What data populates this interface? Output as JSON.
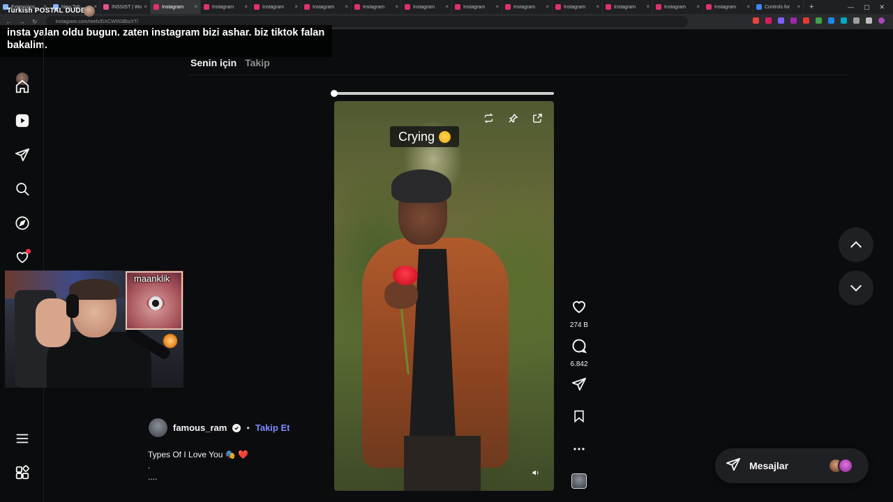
{
  "browser": {
    "tabs": [
      {
        "label": "Extensions",
        "color": "#8ab4f8"
      },
      {
        "label": "New Tab",
        "color": "#8ab4f8"
      },
      {
        "label": "INSSIST | Wo",
        "color": "#e8508a"
      },
      {
        "label": "Instagram",
        "color": "#e1306c",
        "active": true
      },
      {
        "label": "Instagram",
        "color": "#e1306c"
      },
      {
        "label": "Instagram",
        "color": "#e1306c"
      },
      {
        "label": "Instagram",
        "color": "#e1306c"
      },
      {
        "label": "Instagram",
        "color": "#e1306c"
      },
      {
        "label": "Instagram",
        "color": "#e1306c"
      },
      {
        "label": "Instagram",
        "color": "#e1306c"
      },
      {
        "label": "Instagram",
        "color": "#e1306c"
      },
      {
        "label": "Instagram",
        "color": "#e1306c"
      },
      {
        "label": "Instagram",
        "color": "#e1306c"
      },
      {
        "label": "Instagram",
        "color": "#e1306c"
      },
      {
        "label": "Instagram",
        "color": "#e1306c"
      },
      {
        "label": "Controls for",
        "color": "#4285f4"
      }
    ],
    "url": "instagram.com/reels/DXCW5GBbzXT/"
  },
  "stream": {
    "channel_name": "Turkish POSTAL DUDE",
    "chat_message": "insta yalan oldu bugun. zaten instagram bizi ashar. biz tiktok falan bakalim.",
    "pip_label": "maanklik"
  },
  "feed": {
    "tabs": [
      {
        "label": "Senin için",
        "active": true
      },
      {
        "label": "Takip",
        "active": false
      }
    ],
    "progress": 0.0
  },
  "video": {
    "caption": "Crying"
  },
  "actions": {
    "likes": "274 B",
    "comments": "6.842"
  },
  "post": {
    "author": "famous_ram",
    "separator": "•",
    "follow_label": "Takip Et",
    "description_lines": [
      "Types Of I Love You 🎭 ❤️",
      ".",
      "...."
    ]
  },
  "messages": {
    "label": "Mesajlar"
  },
  "colors": {
    "accent": "#7c8cff",
    "background": "#0b0c0e",
    "notification": "#ff3040"
  }
}
